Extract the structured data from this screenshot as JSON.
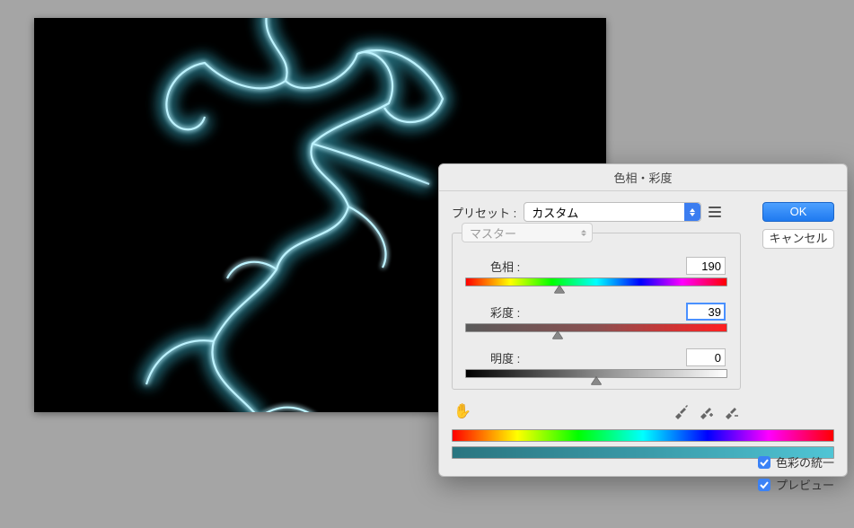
{
  "dialog": {
    "title": "色相・彩度",
    "preset_label": "プリセット :",
    "preset_value": "カスタム",
    "master_label": "マスター",
    "ok_label": "OK",
    "cancel_label": "キャンセル",
    "hue": {
      "label": "色相 :",
      "value": "190",
      "min": -180,
      "max": 180,
      "pos_percent": 36
    },
    "saturation": {
      "label": "彩度 :",
      "value": "39",
      "min": -100,
      "max": 100,
      "pos_percent": 35
    },
    "lightness": {
      "label": "明度 :",
      "value": "0",
      "min": -100,
      "max": 100,
      "pos_percent": 50
    },
    "colorize_label": "色彩の統一",
    "preview_label": "プレビュー",
    "colorize_checked": true,
    "preview_checked": true
  }
}
